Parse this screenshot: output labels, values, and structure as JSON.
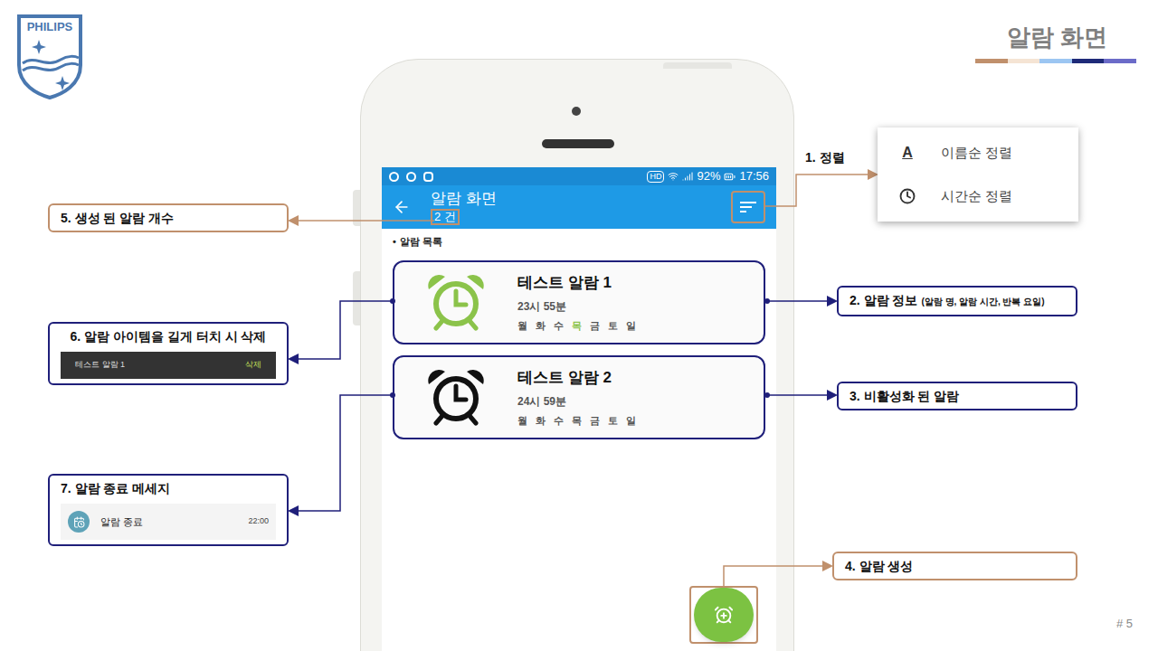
{
  "logo": "PHILIPS",
  "page_title": "알람 화면",
  "page_number": "# 5",
  "phone": {
    "status_bar": {
      "badge": "HD",
      "battery": "92%",
      "time": "17:56"
    },
    "header": {
      "title": "알람 화면",
      "count": "2 건"
    },
    "section": {
      "bullet": "•",
      "label": "알람 목록"
    },
    "alarms": [
      {
        "name": "테스트 알람 1",
        "time": "23시 55분",
        "active": true,
        "days": [
          {
            "label": "월",
            "selected": false
          },
          {
            "label": "화",
            "selected": false
          },
          {
            "label": "수",
            "selected": false
          },
          {
            "label": "목",
            "selected": true
          },
          {
            "label": "금",
            "selected": false
          },
          {
            "label": "토",
            "selected": false
          },
          {
            "label": "일",
            "selected": false
          }
        ]
      },
      {
        "name": "테스트 알람 2",
        "time": "24시 59분",
        "active": false,
        "days": [
          {
            "label": "월",
            "selected": false
          },
          {
            "label": "화",
            "selected": false
          },
          {
            "label": "수",
            "selected": false
          },
          {
            "label": "목",
            "selected": false
          },
          {
            "label": "금",
            "selected": false
          },
          {
            "label": "토",
            "selected": false
          },
          {
            "label": "일",
            "selected": false
          }
        ]
      }
    ]
  },
  "sort_menu": {
    "items": [
      {
        "label": "이름순 정렬",
        "kind": "glyph",
        "glyph": "A"
      },
      {
        "label": "시간순 정렬",
        "kind": "clock"
      }
    ]
  },
  "annotations": [
    {
      "title": "1. 정렬",
      "color": "#c0906c",
      "boxed": false
    },
    {
      "title": "2. 알람 정보",
      "note": "(알람 명, 알람 시간, 반복 요일)",
      "color": "#1f1f7a",
      "boxed": true
    },
    {
      "title": "3. 비활성화 된 알람",
      "color": "#1f1f7a",
      "boxed": true
    },
    {
      "title": "4. 알람 생성",
      "color": "#c0906c",
      "boxed": true
    },
    {
      "title": "5. 생성 된 알람 개수",
      "color": "#c0906c",
      "boxed": true
    },
    {
      "title": "6. 알람 아이템을 길게 터치 시 삭제",
      "color": "#1f1f7a",
      "boxed": true,
      "example": {
        "kind": "delete-bar",
        "item": "테스트 알람 1",
        "action": "삭제"
      }
    },
    {
      "title": "7. 알람 종료 메세지",
      "color": "#1f1f7a",
      "boxed": true,
      "example": {
        "kind": "notification",
        "title": "알람 종료",
        "time": "22:00"
      }
    }
  ]
}
